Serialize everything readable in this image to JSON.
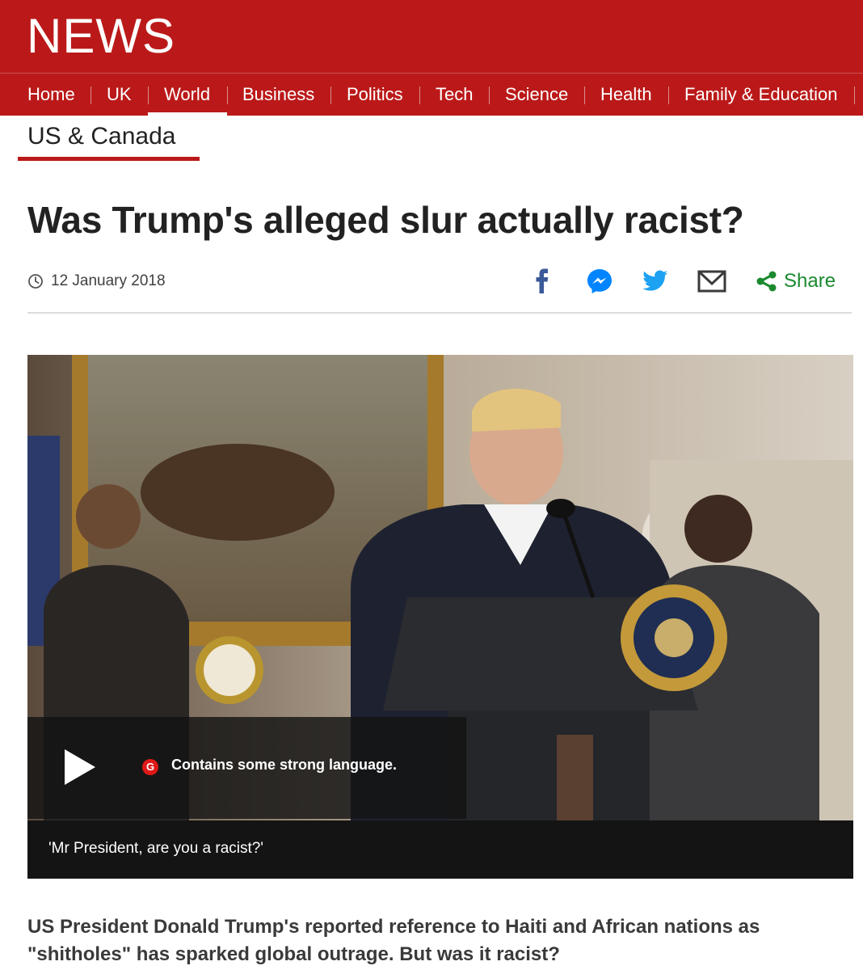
{
  "header": {
    "brand": "NEWS",
    "nav": [
      {
        "label": "Home"
      },
      {
        "label": "UK"
      },
      {
        "label": "World",
        "active": true
      },
      {
        "label": "Business"
      },
      {
        "label": "Politics"
      },
      {
        "label": "Tech"
      },
      {
        "label": "Science"
      },
      {
        "label": "Health"
      },
      {
        "label": "Family & Education"
      }
    ],
    "subnav": "US & Canada"
  },
  "article": {
    "headline": "Was Trump's alleged slur actually racist?",
    "date": "12 January 2018",
    "share": {
      "icons": [
        "facebook-icon",
        "messenger-icon",
        "twitter-icon",
        "email-icon",
        "share-icon"
      ],
      "label": "Share"
    },
    "media": {
      "warning_badge": "G",
      "warning": "Contains some strong language.",
      "caption": "'Mr President, are you a racist?'"
    },
    "summary": "US President Donald Trump's reported reference to Haiti and African nations as \"shitholes\" has sparked global outrage. But was it racist?"
  },
  "colors": {
    "brand_red": "#bb1919",
    "share_green": "#1b8a2f",
    "facebook_blue": "#3b5998",
    "messenger_blue": "#0084ff",
    "twitter_blue": "#1da1f2"
  }
}
